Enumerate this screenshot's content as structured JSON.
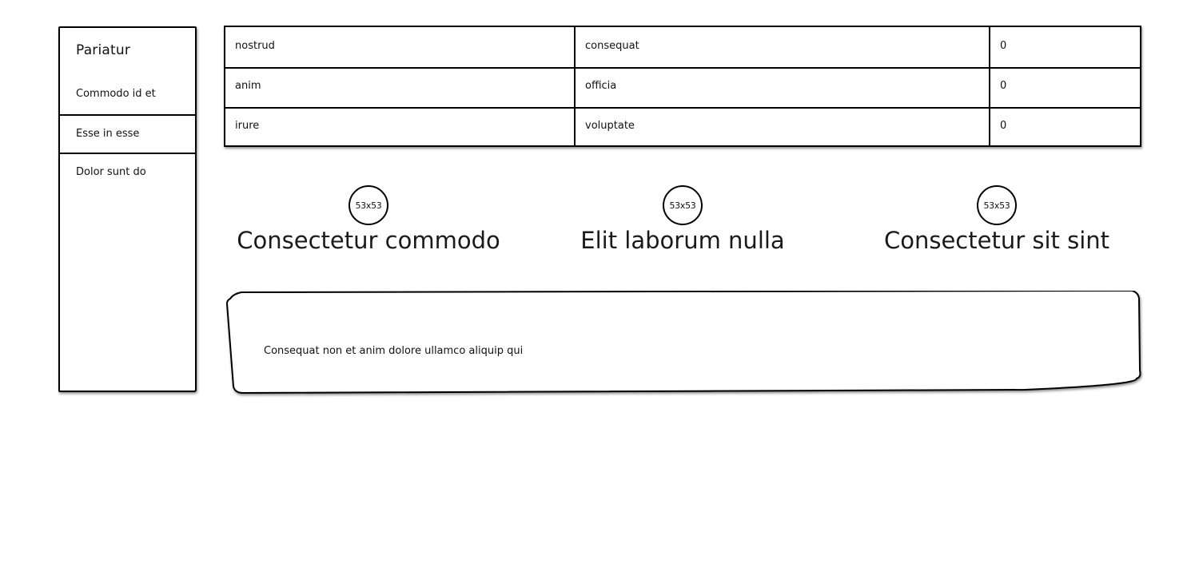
{
  "sidebar": {
    "title": "Pariatur",
    "items": [
      {
        "label": "Commodo id et"
      },
      {
        "label": "Esse in esse"
      },
      {
        "label": "Dolor sunt do"
      }
    ]
  },
  "table": {
    "rows": [
      [
        "nostrud",
        "consequat",
        "0"
      ],
      [
        "anim",
        "officia",
        "0"
      ],
      [
        "irure",
        "voluptate",
        "0"
      ]
    ]
  },
  "features": [
    {
      "avatar": "53x53",
      "heading": "Consectetur commodo"
    },
    {
      "avatar": "53x53",
      "heading": "Elit laborum nulla"
    },
    {
      "avatar": "53x53",
      "heading": "Consectetur sit sint"
    }
  ],
  "panel": {
    "text": "Consequat non et anim dolore ullamco aliquip qui"
  }
}
